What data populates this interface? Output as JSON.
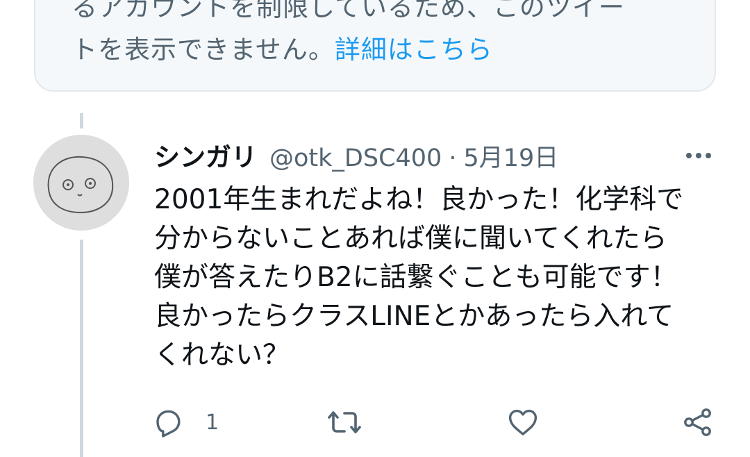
{
  "notice": {
    "line1": "るアカウントを制限しているため、このツイー",
    "line2": "トを表示できません。",
    "link": "詳細はこちら"
  },
  "tweet": {
    "display_name": "シンガリ",
    "handle": "@otk_DSC400",
    "separator": "·",
    "date": "5月19日",
    "text_lines": [
      "2001年生まれだよね！良かった！化学科で",
      "分からないことあれば僕に聞いてくれたら",
      "僕が答えたりB2に話繋ぐことも可能です！",
      "良かったらクラスLINEとかあったら入れて",
      "くれない？"
    ],
    "reply_count": "1"
  },
  "icons": {
    "reply": "reply-icon",
    "retweet": "retweet-icon",
    "like": "heart-icon",
    "share": "share-icon",
    "more": "more-icon"
  },
  "colors": {
    "link": "#1d9bf0",
    "secondary_text": "#536471",
    "card_background": "#f5f8fa",
    "thread_line": "#cfd9de"
  }
}
